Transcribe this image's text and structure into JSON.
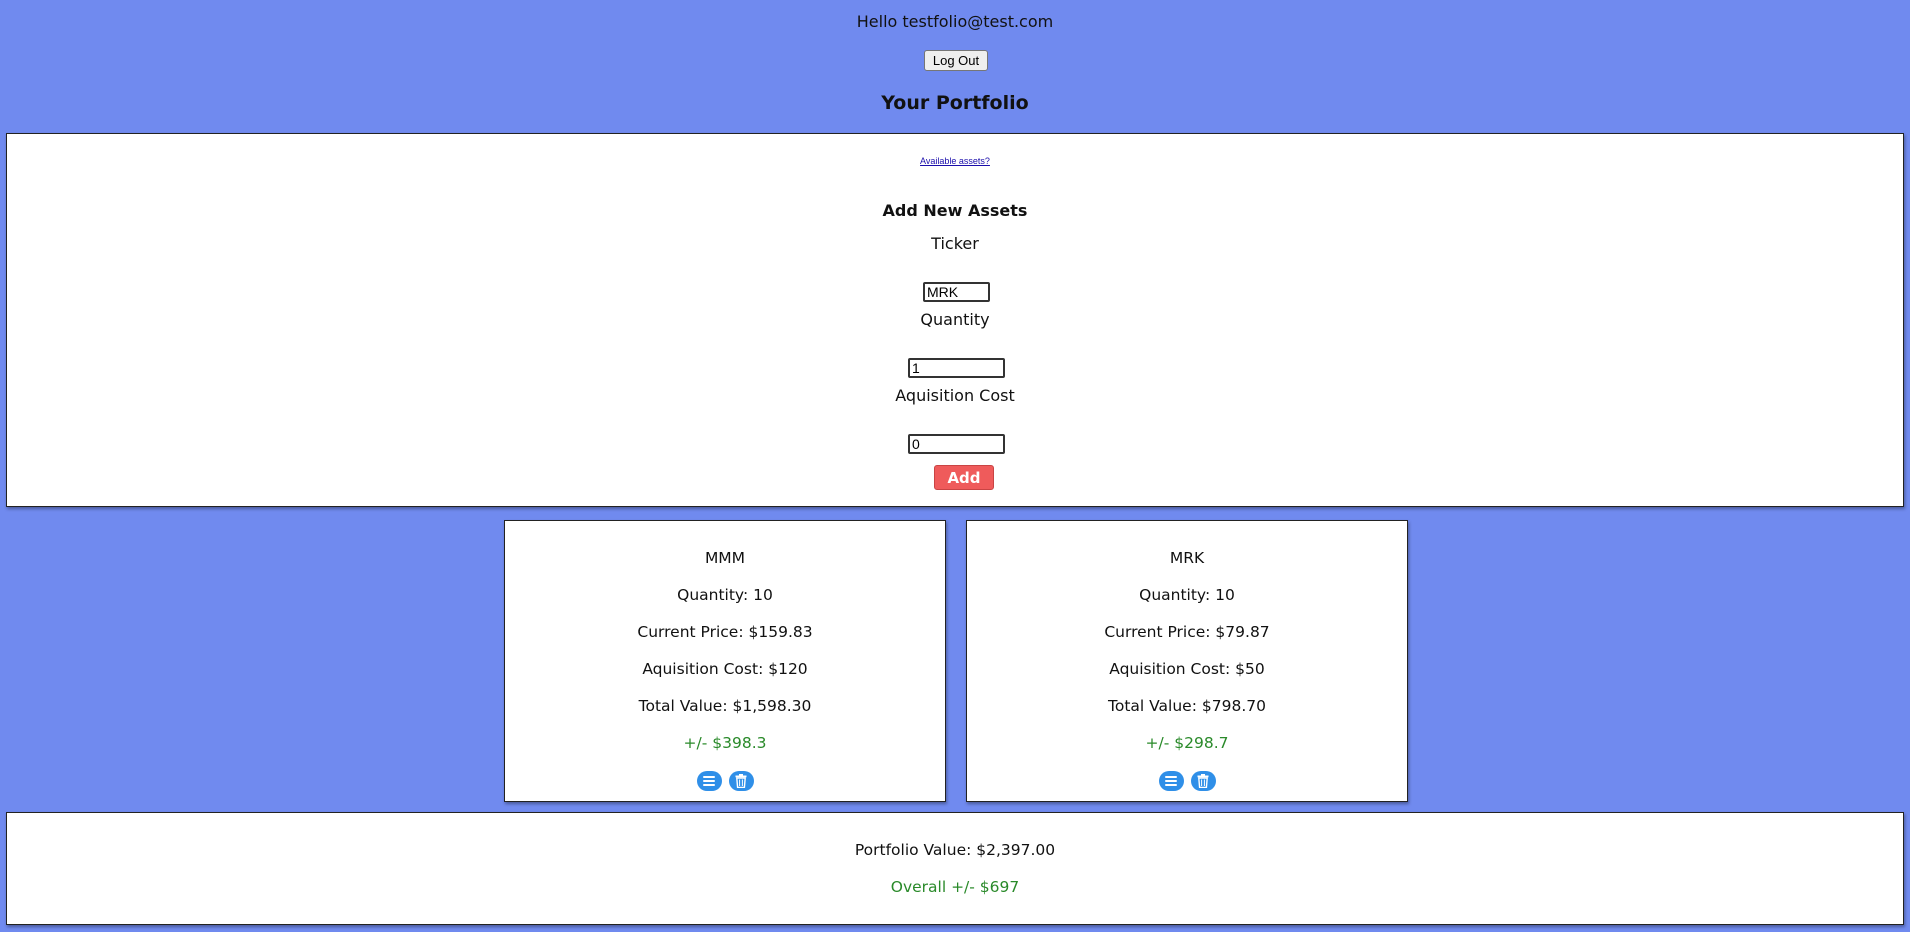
{
  "header": {
    "greeting": "Hello testfolio@test.com",
    "logout_label": "Log Out",
    "title": "Your Portfolio"
  },
  "add_form": {
    "available_link": "Available assets?",
    "heading": "Add New Assets",
    "ticker_label": "Ticker",
    "ticker_value": "MRK",
    "quantity_label": "Quantity",
    "quantity_value": "1",
    "cost_label": "Aquisition Cost",
    "cost_value": "0",
    "add_label": "Add"
  },
  "assets": [
    {
      "ticker": "MMM",
      "quantity": "Quantity: 10",
      "current_price": "Current Price: $159.83",
      "acquisition_cost": "Aquisition Cost: $120",
      "total_value": "Total Value: $1,598.30",
      "gain": "+/- $398.3"
    },
    {
      "ticker": "MRK",
      "quantity": "Quantity: 10",
      "current_price": "Current Price: $79.87",
      "acquisition_cost": "Aquisition Cost: $50",
      "total_value": "Total Value: $798.70",
      "gain": "+/- $298.7"
    }
  ],
  "summary": {
    "portfolio_value": "Portfolio Value: $2,397.00",
    "overall_gain": "Overall +/- $697"
  },
  "colors": {
    "background": "#708aef",
    "add_button": "#ef5b5b",
    "gain_text": "#2a8a2a",
    "icon_button": "#2f8fe8"
  },
  "icons": {
    "details": "list-icon",
    "delete": "trash-icon"
  }
}
